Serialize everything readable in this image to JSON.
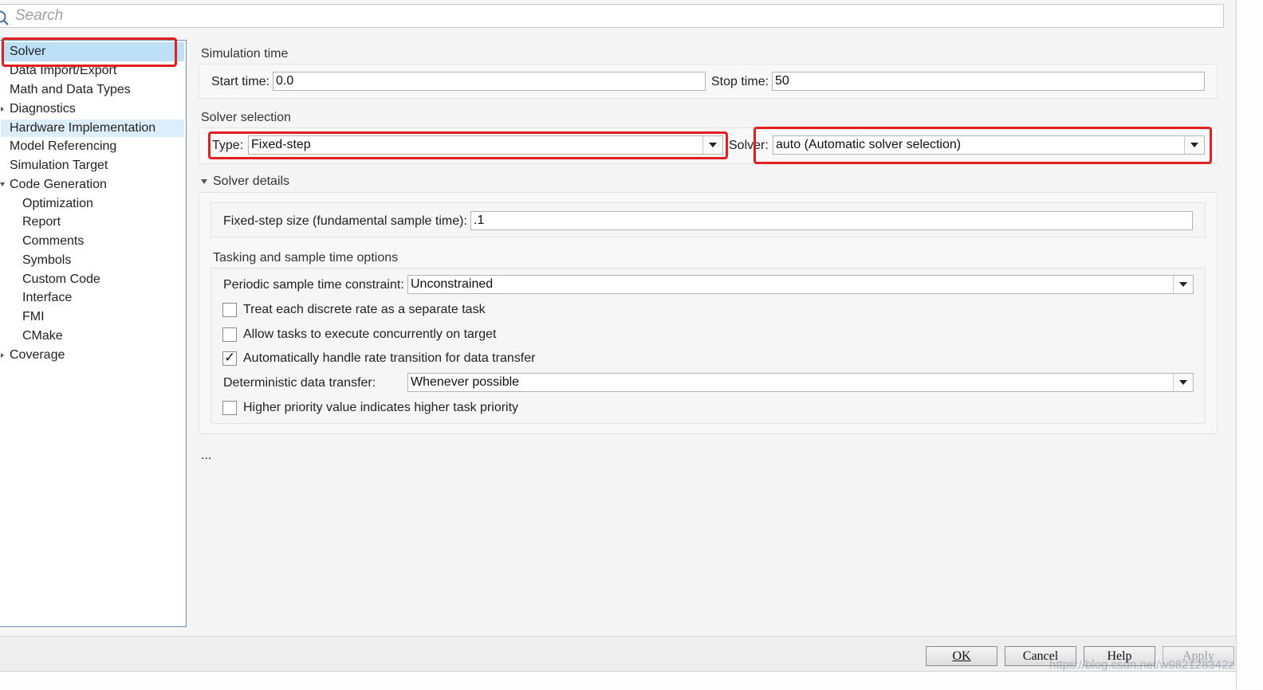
{
  "search": {
    "placeholder": "Search"
  },
  "nav": {
    "items": [
      {
        "label": "Solver"
      },
      {
        "label": "Data Import/Export"
      },
      {
        "label": "Math and Data Types"
      },
      {
        "label": "Diagnostics"
      },
      {
        "label": "Hardware Implementation"
      },
      {
        "label": "Model Referencing"
      },
      {
        "label": "Simulation Target"
      },
      {
        "label": "Code Generation"
      },
      {
        "label": "Optimization"
      },
      {
        "label": "Report"
      },
      {
        "label": "Comments"
      },
      {
        "label": "Symbols"
      },
      {
        "label": "Custom Code"
      },
      {
        "label": "Interface"
      },
      {
        "label": "FMI"
      },
      {
        "label": "CMake"
      },
      {
        "label": "Coverage"
      }
    ]
  },
  "simulation_time": {
    "title": "Simulation time",
    "start_label": "Start time:",
    "start_value": "0.0",
    "stop_label": "Stop time:",
    "stop_value": "50"
  },
  "solver_selection": {
    "title": "Solver selection",
    "type_label": "Type:",
    "type_value": "Fixed-step",
    "solver_label": "Solver:",
    "solver_value": "auto (Automatic solver selection)"
  },
  "solver_details": {
    "title": "Solver details",
    "step_size_label": "Fixed-step size (fundamental sample time):",
    "step_size_value": ".1"
  },
  "tasking": {
    "title": "Tasking and sample time options",
    "periodic_label": "Periodic sample time constraint:",
    "periodic_value": "Unconstrained",
    "opt_discrete_rate": "Treat each discrete rate as a separate task",
    "opt_concurrent": "Allow tasks to execute concurrently on target",
    "opt_rate_transition": "Automatically handle rate transition for data transfer",
    "deterministic_label": "Deterministic data transfer:",
    "deterministic_value": "Whenever possible",
    "opt_priority": "Higher priority value indicates higher task priority",
    "checkmark": "✓"
  },
  "ellipsis": "...",
  "buttons": {
    "ok": "OK",
    "cancel": "Cancel",
    "help": "Help",
    "apply": "Apply"
  },
  "watermark": "https://blog.csdn.net/w982128342z"
}
